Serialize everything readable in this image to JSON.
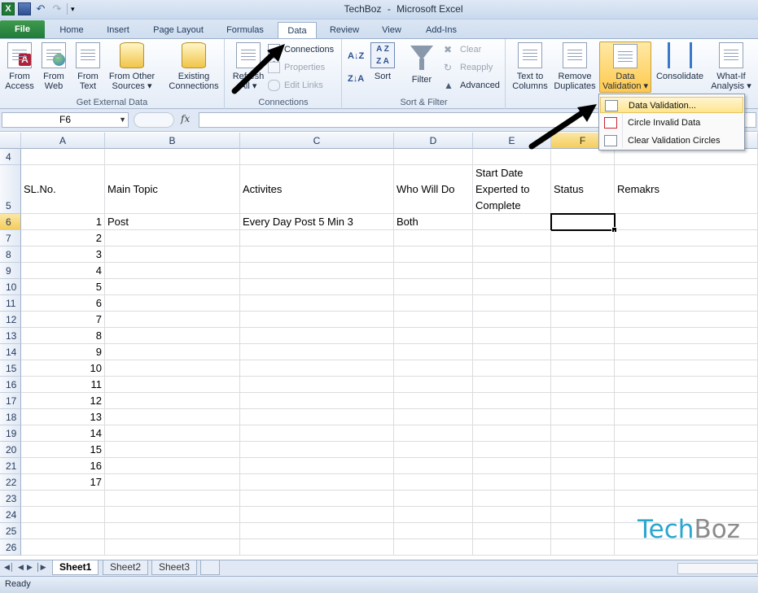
{
  "window": {
    "title_doc": "TechBoz",
    "title_sep": "-",
    "title_app": "Microsoft Excel"
  },
  "qat": {
    "logo_letter": "X"
  },
  "tabs": [
    {
      "label": "File"
    },
    {
      "label": "Home"
    },
    {
      "label": "Insert"
    },
    {
      "label": "Page Layout"
    },
    {
      "label": "Formulas"
    },
    {
      "label": "Data"
    },
    {
      "label": "Review"
    },
    {
      "label": "View"
    },
    {
      "label": "Add-Ins"
    }
  ],
  "ribbon": {
    "get_external": {
      "label": "Get External Data",
      "from_access": [
        "From",
        "Access"
      ],
      "from_web": [
        "From",
        "Web"
      ],
      "from_text": [
        "From",
        "Text"
      ],
      "from_other": [
        "From Other",
        "Sources ▾"
      ],
      "existing": [
        "Existing",
        "Connections"
      ]
    },
    "connections": {
      "label": "Connections",
      "refresh": [
        "Refresh",
        "All ▾"
      ],
      "connections": "Connections",
      "properties": "Properties",
      "edit_links": "Edit Links"
    },
    "sort_filter": {
      "label": "Sort & Filter",
      "sort": "Sort",
      "filter": "Filter",
      "clear": "Clear",
      "reapply": "Reapply",
      "advanced": "Advanced"
    },
    "data_tools": {
      "text_to_columns": [
        "Text to",
        "Columns"
      ],
      "remove_duplicates": [
        "Remove",
        "Duplicates"
      ],
      "data_validation": [
        "Data",
        "Validation ▾"
      ],
      "consolidate": "Consolidate",
      "what_if": [
        "What-If",
        "Analysis ▾"
      ]
    }
  },
  "dropdown": {
    "items": [
      {
        "label": "Data Validation..."
      },
      {
        "label": "Circle Invalid Data"
      },
      {
        "label": "Clear Validation Circles"
      }
    ]
  },
  "formula_bar": {
    "name_box": "F6",
    "fx": "fx",
    "content": ""
  },
  "columns": [
    "A",
    "B",
    "C",
    "D",
    "E",
    "F",
    ""
  ],
  "header_row": {
    "row": "5",
    "a": "SL.No.",
    "b": "Main Topic",
    "c": "Activites",
    "d": "Who  Will Do",
    "e1": "Start Date",
    "e2": "Experted to",
    "e3": "Complete",
    "f": "Status",
    "g": "Remakrs"
  },
  "data_row": {
    "row": "6",
    "a": "1",
    "b": "Post",
    "c": "Every Day Post  5 Min 3",
    "d": "Both"
  },
  "rows": [
    {
      "row": "4",
      "a": ""
    },
    {
      "row": "7",
      "a": "2"
    },
    {
      "row": "8",
      "a": "3"
    },
    {
      "row": "9",
      "a": "4"
    },
    {
      "row": "10",
      "a": "5"
    },
    {
      "row": "11",
      "a": "6"
    },
    {
      "row": "12",
      "a": "7"
    },
    {
      "row": "13",
      "a": "8"
    },
    {
      "row": "14",
      "a": "9"
    },
    {
      "row": "15",
      "a": "10"
    },
    {
      "row": "16",
      "a": "11"
    },
    {
      "row": "17",
      "a": "12"
    },
    {
      "row": "18",
      "a": "13"
    },
    {
      "row": "19",
      "a": "14"
    },
    {
      "row": "20",
      "a": "15"
    },
    {
      "row": "21",
      "a": "16"
    },
    {
      "row": "22",
      "a": "17"
    },
    {
      "row": "23",
      "a": ""
    },
    {
      "row": "24",
      "a": ""
    },
    {
      "row": "25",
      "a": ""
    },
    {
      "row": "26",
      "a": ""
    }
  ],
  "sheets": [
    {
      "label": "Sheet1"
    },
    {
      "label": "Sheet2"
    },
    {
      "label": "Sheet3"
    }
  ],
  "status": {
    "text": "Ready"
  },
  "watermark": {
    "part1": "Tech",
    "part2": "Boz"
  },
  "colors": {
    "accent": "#1f7a38",
    "highlight": "#fde58d",
    "brand_blue": "#2aa6cf"
  }
}
